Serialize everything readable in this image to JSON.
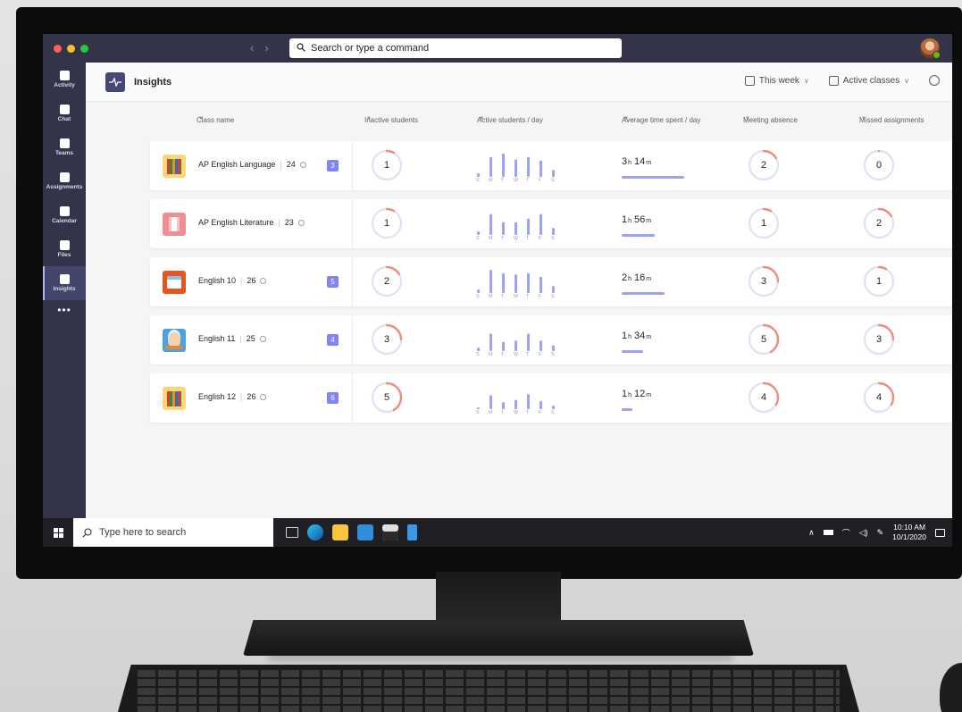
{
  "app": {
    "search_placeholder": "Search or type a command",
    "nav_back": "‹",
    "nav_forward": "›",
    "window_dot_colors": [
      "#ff5f57",
      "#febc2e",
      "#28c840"
    ]
  },
  "sidebar": {
    "items": [
      {
        "label": "Activity",
        "icon": "bell-icon"
      },
      {
        "label": "Chat",
        "icon": "chat-icon"
      },
      {
        "label": "Teams",
        "icon": "teams-icon"
      },
      {
        "label": "Assignments",
        "icon": "assignments-icon"
      },
      {
        "label": "Calendar",
        "icon": "calendar-icon"
      },
      {
        "label": "Files",
        "icon": "files-icon"
      },
      {
        "label": "Insights",
        "icon": "insights-icon",
        "active": true
      }
    ],
    "more": "•••"
  },
  "header": {
    "title": "Insights",
    "period_label": "This week",
    "filter_label": "Active classes"
  },
  "columns": {
    "class_name": "Class name",
    "inactive": "Inactive students",
    "active_per_day": "Active students / day",
    "avg_time": "Average time spent / day",
    "meeting_absence": "Meeting absence",
    "missed_assignments": "Missed assignments"
  },
  "day_letters": [
    "S",
    "M",
    "T",
    "W",
    "T",
    "F",
    "S"
  ],
  "rows": [
    {
      "name": "AP English Language",
      "students": "24",
      "badge": "3",
      "icon": "books",
      "inactive": 1,
      "active_days": [
        0.15,
        0.85,
        1.0,
        0.75,
        0.85,
        0.7,
        0.3
      ],
      "hours": "3",
      "minutes": "14",
      "time_fraction": 0.65,
      "meeting_absence": 2,
      "missed": 0
    },
    {
      "name": "AP English Literature",
      "students": "23",
      "badge": "",
      "icon": "pillar",
      "inactive": 1,
      "active_days": [
        0.15,
        0.9,
        0.55,
        0.55,
        0.7,
        0.9,
        0.3
      ],
      "hours": "1",
      "minutes": "56",
      "time_fraction": 0.34,
      "meeting_absence": 1,
      "missed": 2
    },
    {
      "name": "English 10",
      "students": "26",
      "badge": "5",
      "icon": "news",
      "inactive": 2,
      "active_days": [
        0.15,
        1.0,
        0.85,
        0.8,
        0.85,
        0.7,
        0.3
      ],
      "hours": "2",
      "minutes": "16",
      "time_fraction": 0.44,
      "meeting_absence": 3,
      "missed": 1
    },
    {
      "name": "English 11",
      "students": "25",
      "badge": "4",
      "icon": "face",
      "inactive": 3,
      "active_days": [
        0.15,
        0.75,
        0.4,
        0.45,
        0.75,
        0.45,
        0.25
      ],
      "hours": "1",
      "minutes": "34",
      "time_fraction": 0.22,
      "meeting_absence": 5,
      "missed": 3
    },
    {
      "name": "English 12",
      "students": "26",
      "badge": "6",
      "icon": "books",
      "inactive": 5,
      "active_days": [
        0.0,
        0.6,
        0.3,
        0.4,
        0.65,
        0.35,
        0.15
      ],
      "hours": "1",
      "minutes": "12",
      "time_fraction": 0.11,
      "meeting_absence": 4,
      "missed": 4
    }
  ],
  "units": {
    "hours": "h",
    "minutes": "m"
  },
  "taskbar": {
    "search_placeholder": "Type here to search",
    "time": "10:10 AM",
    "date": "10/1/2020"
  },
  "colors": {
    "ring_track": "#e1e0f5",
    "ring_accent": "#ef8c7c",
    "bar": "#9ea2f2",
    "sidebar_bg": "#33344a"
  }
}
